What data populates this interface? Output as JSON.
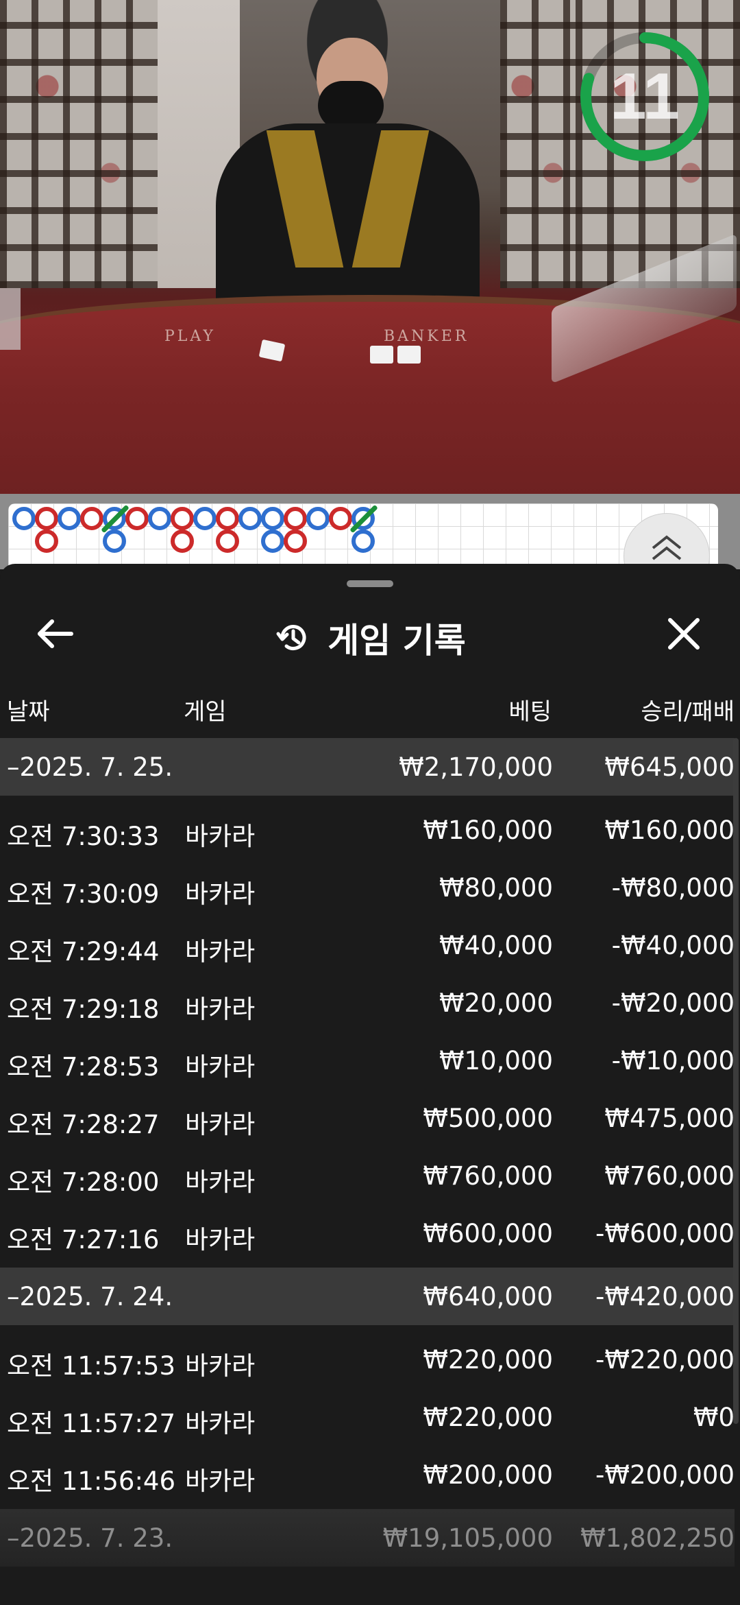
{
  "video": {
    "table_labels": {
      "player": "PLAY",
      "banker": "BANKER"
    },
    "timer": {
      "value": "11",
      "ring_color": "#1aa34a",
      "progress": 0.8
    }
  },
  "roadmap": {
    "colors": {
      "player": "#2f6fcf",
      "banker": "#cc2a2a",
      "tie": "#1c8f3a"
    },
    "toggle_icon": "double-chevron-up-icon"
  },
  "history": {
    "title": "게임 기록",
    "title_icon": "history-icon",
    "back_icon": "arrow-left-icon",
    "close_icon": "close-icon",
    "columns": {
      "date": "날짜",
      "game": "게임",
      "bet": "베팅",
      "result": "승리/패배"
    },
    "groups": [
      {
        "date": "–2025. 7. 25.",
        "bet_total": "₩2,170,000",
        "result_total": "₩645,000",
        "rows": [
          {
            "time": "오전 7:30:33",
            "game": "바카라",
            "bet": "₩160,000",
            "result": "₩160,000"
          },
          {
            "time": "오전 7:30:09",
            "game": "바카라",
            "bet": "₩80,000",
            "result": "-₩80,000"
          },
          {
            "time": "오전 7:29:44",
            "game": "바카라",
            "bet": "₩40,000",
            "result": "-₩40,000"
          },
          {
            "time": "오전 7:29:18",
            "game": "바카라",
            "bet": "₩20,000",
            "result": "-₩20,000"
          },
          {
            "time": "오전 7:28:53",
            "game": "바카라",
            "bet": "₩10,000",
            "result": "-₩10,000"
          },
          {
            "time": "오전 7:28:27",
            "game": "바카라",
            "bet": "₩500,000",
            "result": "₩475,000"
          },
          {
            "time": "오전 7:28:00",
            "game": "바카라",
            "bet": "₩760,000",
            "result": "₩760,000"
          },
          {
            "time": "오전 7:27:16",
            "game": "바카라",
            "bet": "₩600,000",
            "result": "-₩600,000"
          }
        ]
      },
      {
        "date": "–2025. 7. 24.",
        "bet_total": "₩640,000",
        "result_total": "-₩420,000",
        "rows": [
          {
            "time": "오전 11:57:53",
            "game": "바카라",
            "bet": "₩220,000",
            "result": "-₩220,000"
          },
          {
            "time": "오전 11:57:27",
            "game": "바카라",
            "bet": "₩220,000",
            "result": "₩0"
          },
          {
            "time": "오전 11:56:46",
            "game": "바카라",
            "bet": "₩200,000",
            "result": "-₩200,000"
          }
        ]
      },
      {
        "date": "–2025. 7. 23.",
        "bet_total": "₩19,105,000",
        "result_total": "₩1,802,250",
        "rows": []
      }
    ]
  }
}
